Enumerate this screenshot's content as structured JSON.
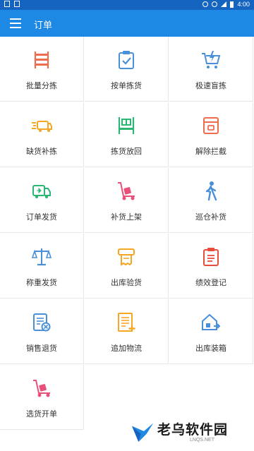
{
  "status_bar": {
    "time": "4:00"
  },
  "app_bar": {
    "title": "订单"
  },
  "menu": {
    "items": [
      {
        "label": "批量分拣",
        "icon": "shelf-icon",
        "color": "#ef6c4f"
      },
      {
        "label": "按单拣货",
        "icon": "clipboard-check-icon",
        "color": "#4a90d9"
      },
      {
        "label": "极速盲拣",
        "icon": "cart-lightning-icon",
        "color": "#4a90d9"
      },
      {
        "label": "缺货补拣",
        "icon": "truck-fast-icon",
        "color": "#f5a623"
      },
      {
        "label": "拣货放回",
        "icon": "box-return-icon",
        "color": "#2bb673"
      },
      {
        "label": "解除拦截",
        "icon": "package-unlock-icon",
        "color": "#ef6c4f"
      },
      {
        "label": "订单发货",
        "icon": "delivery-truck-icon",
        "color": "#2bb673"
      },
      {
        "label": "补货上架",
        "icon": "hand-truck-icon",
        "color": "#e8507a"
      },
      {
        "label": "巡仓补货",
        "icon": "walking-person-icon",
        "color": "#4a90d9"
      },
      {
        "label": "称重发货",
        "icon": "scale-icon",
        "color": "#4a90d9"
      },
      {
        "label": "出库验货",
        "icon": "receipt-printer-icon",
        "color": "#f5a623"
      },
      {
        "label": "绩效登记",
        "icon": "clipboard-list-icon",
        "color": "#e74c3c"
      },
      {
        "label": "销售退货",
        "icon": "return-form-icon",
        "color": "#4a90d9"
      },
      {
        "label": "追加物流",
        "icon": "document-add-icon",
        "color": "#f5a623"
      },
      {
        "label": "出库装箱",
        "icon": "warehouse-box-icon",
        "color": "#4a90d9"
      },
      {
        "label": "选货开单",
        "icon": "trolley-icon",
        "color": "#e8507a"
      }
    ]
  },
  "watermark": {
    "text": "老乌软件园",
    "sub": "LNQS.NET"
  }
}
